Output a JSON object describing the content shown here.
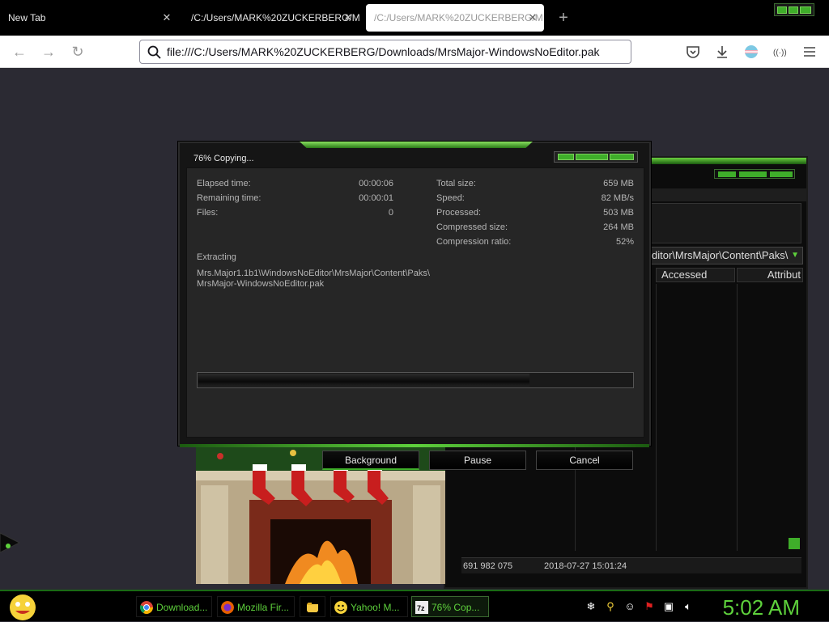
{
  "browser": {
    "tabs": [
      {
        "label": "New Tab"
      },
      {
        "label": "/C:/Users/MARK%20ZUCKERBERG/M"
      },
      {
        "label": "/C:/Users/MARK%20ZUCKERBERG/M"
      }
    ],
    "url": "file:///C:/Users/MARK%20ZUCKERBERG/Downloads/MrsMajor-WindowsNoEditor.pak"
  },
  "file_manager": {
    "path": "ditor\\MrsMajor\\Content\\Paks\\",
    "columns": [
      "Accessed",
      "Attribut"
    ],
    "status_size": "691 982 075",
    "status_date": "2018-07-27 15:01:24"
  },
  "copy_dialog": {
    "title": "76% Copying...",
    "progress_percent": 76,
    "left_stats": [
      {
        "label": "Elapsed time:",
        "value": "00:00:06"
      },
      {
        "label": "Remaining time:",
        "value": "00:00:01"
      },
      {
        "label": "Files:",
        "value": "0"
      }
    ],
    "right_stats": [
      {
        "label": "Total size:",
        "value": "659 MB"
      },
      {
        "label": "Speed:",
        "value": "82 MB/s"
      },
      {
        "label": "Processed:",
        "value": "503 MB"
      },
      {
        "label": "Compressed size:",
        "value": "264 MB"
      },
      {
        "label": "Compression ratio:",
        "value": "52%"
      }
    ],
    "operation": "Extracting",
    "file_line1": "Mrs.Major1.1b1\\WindowsNoEditor\\MrsMajor\\Content\\Paks\\",
    "file_line2": "MrsMajor-WindowsNoEditor.pak",
    "buttons": {
      "background": "Background",
      "pause": "Pause",
      "cancel": "Cancel"
    }
  },
  "taskbar": {
    "items": [
      {
        "label": "Download...",
        "icon": "chrome-icon"
      },
      {
        "label": "Mozilla Fir...",
        "icon": "firefox-icon"
      },
      {
        "label": "",
        "icon": "folder-icon"
      },
      {
        "label": "Yahoo! M...",
        "icon": "yahoo-messenger-icon"
      },
      {
        "label": "76% Cop...",
        "icon": "7zip-icon"
      }
    ],
    "clock": "5:02 AM"
  },
  "colors": {
    "accent": "#3fae2a",
    "clock": "#5ed13c"
  }
}
